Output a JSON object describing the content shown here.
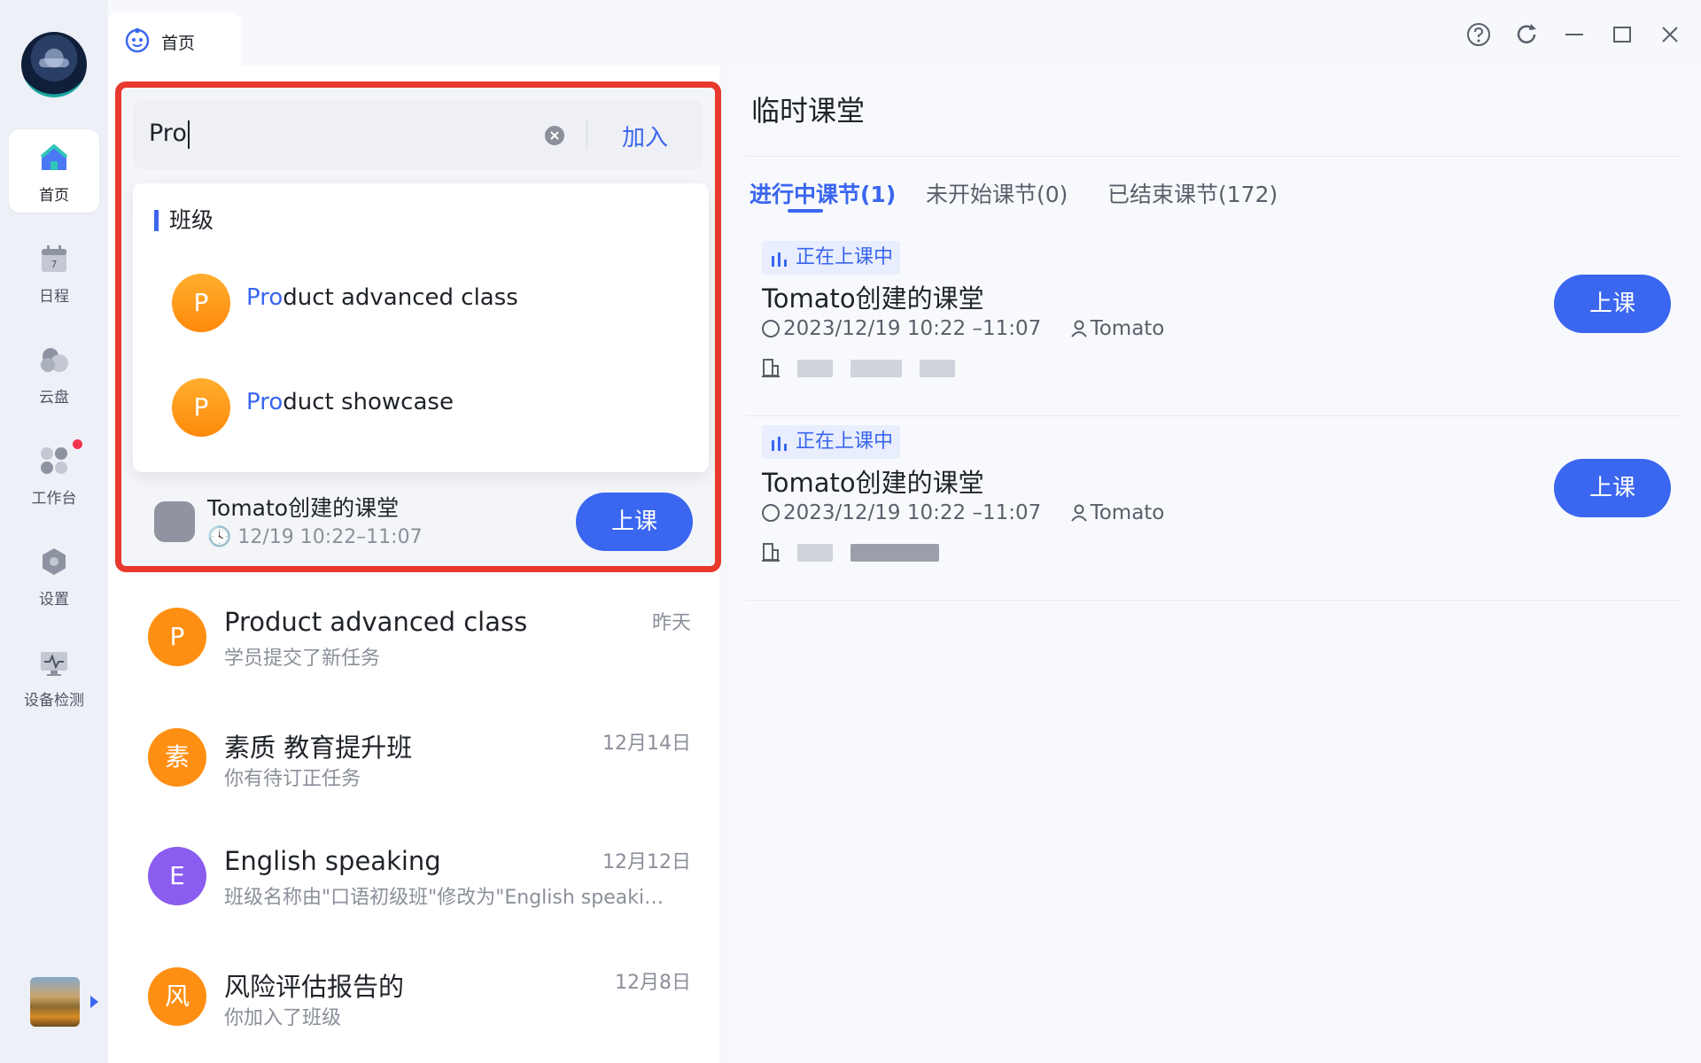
{
  "nav": {
    "items": [
      {
        "label": "首页",
        "icon": "home-icon"
      },
      {
        "label": "日程",
        "icon": "calendar-icon",
        "calendar_day": "7"
      },
      {
        "label": "云盘",
        "icon": "cloud-icon"
      },
      {
        "label": "工作台",
        "icon": "workbench-icon"
      },
      {
        "label": "设置",
        "icon": "settings-icon"
      },
      {
        "label": "设备检测",
        "icon": "device-check-icon"
      }
    ]
  },
  "tab": {
    "label": "首页"
  },
  "search": {
    "value": "Pro",
    "join_label": "加入"
  },
  "dropdown": {
    "header": "班级",
    "results": [
      {
        "avatar": "P",
        "match": "Pro",
        "rest": "duct advanced class"
      },
      {
        "avatar": "P",
        "match": "Pro",
        "rest": "duct showcase"
      }
    ]
  },
  "under_card": {
    "title": "Tomato创建的课堂",
    "time": "12/19 10:22–11:07",
    "button": "上课"
  },
  "chats": [
    {
      "avatar": "P",
      "name": "Product advanced class",
      "sub": "学员提交了新任务",
      "date": "昨天",
      "color": "#ff8f12"
    },
    {
      "avatar": "素",
      "name": "素质 教育提升班",
      "sub": "你有待订正任务",
      "date": "12月14日",
      "color": "#ff8f12"
    },
    {
      "avatar": "E",
      "name": "English speaking",
      "sub": "班级名称由\"口语初级班\"修改为\"English speaki…",
      "date": "12月12日",
      "color": "#8a5cf0"
    },
    {
      "avatar": "风",
      "name": "风险评估报告的",
      "sub": "你加入了班级",
      "date": "12月8日",
      "color": "#ff8f12"
    }
  ],
  "right": {
    "title": "临时课堂",
    "tabs": [
      "进行中课节(1)",
      "未开始课节(0)",
      "已结束课节(172)"
    ],
    "lessons": [
      {
        "badge": "正在上课中",
        "title": "Tomato创建的课堂",
        "time": "2023/12/19 10:22 –11:07",
        "teacher": "Tomato",
        "button": "上课"
      },
      {
        "badge": "正在上课中",
        "title": "Tomato创建的课堂",
        "time": "2023/12/19 10:22 –11:07",
        "teacher": "Tomato",
        "button": "上课"
      }
    ]
  },
  "colors": {
    "accent": "#3a66f0",
    "highlight_border": "#e8392e",
    "badge_red": "#f2344e"
  }
}
